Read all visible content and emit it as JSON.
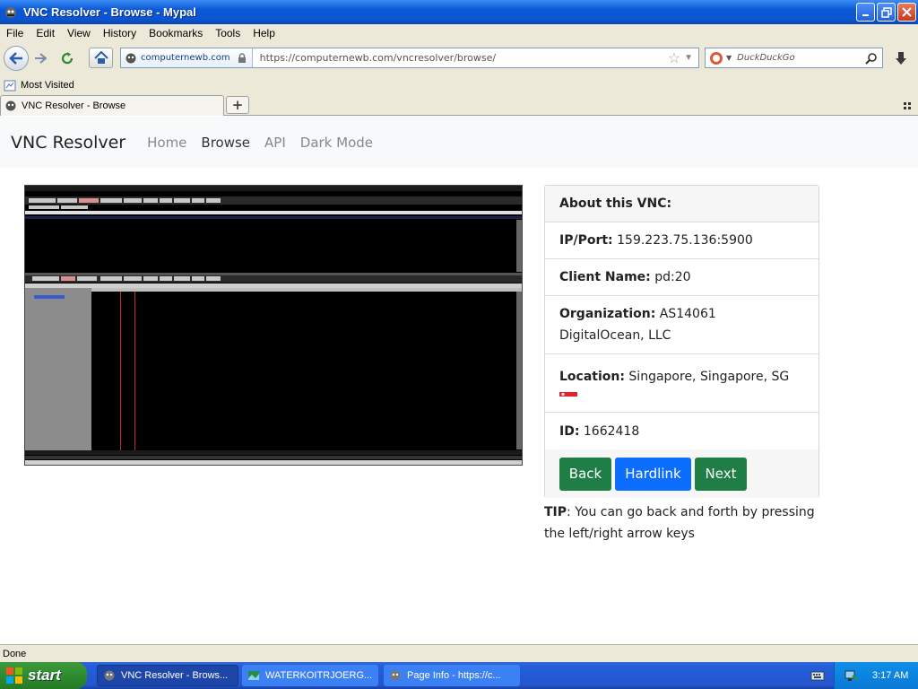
{
  "window": {
    "title": "VNC Resolver - Browse - Mypal"
  },
  "menu": [
    "File",
    "Edit",
    "View",
    "History",
    "Bookmarks",
    "Tools",
    "Help"
  ],
  "toolbar": {
    "identity": "computernewb.com",
    "url": "https://computernewb.com/vncresolver/browse/",
    "search_placeholder": "DuckDuckGo"
  },
  "bookmarks": {
    "most_visited": "Most Visited"
  },
  "tab": {
    "label": "VNC Resolver - Browse"
  },
  "site": {
    "brand": "VNC Resolver",
    "nav": [
      "Home",
      "Browse",
      "API",
      "Dark Mode"
    ]
  },
  "card": {
    "header": "About this VNC:",
    "ip_label": "IP/Port:",
    "ip_value": "159.223.75.136:5900",
    "client_label": "Client Name:",
    "client_value": "pd:20",
    "org_label": "Organization:",
    "org_value": "AS14061 DigitalOcean, LLC",
    "location_label": "Location:",
    "location_value": "Singapore, Singapore, SG",
    "id_label": "ID:",
    "id_value": "1662418",
    "buttons": {
      "back": "Back",
      "hardlink": "Hardlink",
      "next": "Next"
    }
  },
  "tip": {
    "bold": "TIP",
    "text": ": You can go back and forth by pressing the left/right arrow keys"
  },
  "status": "Done",
  "taskbar": {
    "start": "start",
    "items": [
      "VNC Resolver - Brows...",
      "WATERKOITRJOERG...",
      "Page Info - https://c..."
    ],
    "clock": "3:17 AM"
  },
  "colors": {
    "back_button": "#1e7e45",
    "hardlink_button": "#0d6efd",
    "next_button": "#1e7e45"
  }
}
